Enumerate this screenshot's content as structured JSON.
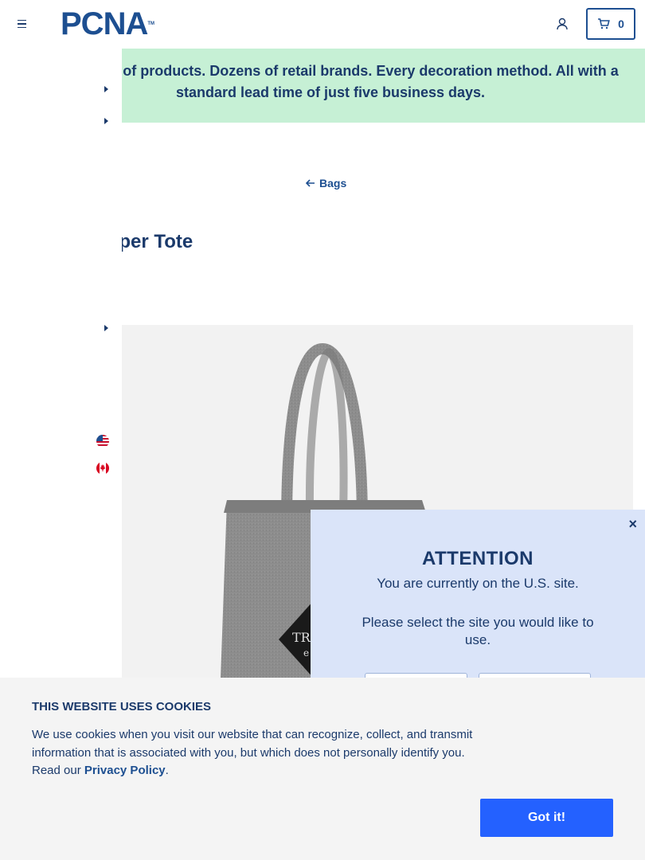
{
  "header": {
    "logo_text": "PCNA",
    "logo_tm": "TM",
    "cart_count": "0"
  },
  "banner": {
    "text": "Thousands of products. Dozens of retail brands. Every decoration method. All with a standard lead time of just five business days.",
    "background": "#c6f0d5"
  },
  "breadcrumb": {
    "label": "Bags"
  },
  "product": {
    "title": "Felt Shopper Tote",
    "tote_print_1": "TR",
    "tote_print_2": "e"
  },
  "modal": {
    "title": "ATTENTION",
    "line1": "You are currently on the U.S. site.",
    "line2": "Please select the site you would like to use.",
    "close": "×"
  },
  "cookie": {
    "title": "THIS WEBSITE USES COOKIES",
    "text": "We use cookies when you visit our website that can recognize, collect, and transmit information that is associated with you, but which does not personally identify you. Read our",
    "link": "Privacy Policy",
    "period": ".",
    "button": "Got it!"
  },
  "colors": {
    "brand_navy": "#1b3a6b",
    "brand_blue": "#1d4f91",
    "cta_blue": "#2461ff",
    "modal_bg": "#dae4f9"
  }
}
